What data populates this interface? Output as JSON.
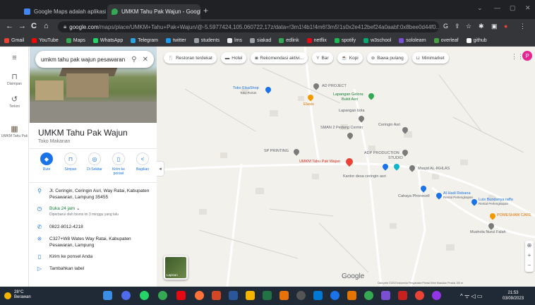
{
  "browser": {
    "tabs": [
      {
        "title": "Google Maps adalah aplikasi..",
        "close": "×",
        "active": false
      },
      {
        "title": "UMKM Tahu Pak Wajun - Googl",
        "close": "×",
        "active": true
      }
    ],
    "new_tab": "+",
    "window_controls": [
      "⌄",
      "—",
      "▢",
      "✕"
    ],
    "nav": {
      "back": "←",
      "forward": "→",
      "reload": "C",
      "home": "⌂"
    },
    "url_host": "google.com",
    "url_path": "/maps/place/UMKM+Tahu+Pak+Wajun/@-5.5977424,105.060722,17z/data=!3m1!4b1!4m6!3m5!1s0x2e412bef24a0aabf:0x8bee0d44f0...",
    "toolbar_icons": [
      "G",
      "⇪",
      "☆",
      "✱",
      "▣",
      "●",
      "⋮"
    ]
  },
  "bookmarks": [
    {
      "label": "Gmail",
      "color": "#ea4335"
    },
    {
      "label": "YouTube",
      "color": "#ff0000"
    },
    {
      "label": "Maps",
      "color": "#34a853"
    },
    {
      "label": "WhatsApp",
      "color": "#25d366"
    },
    {
      "label": "Telegram",
      "color": "#2aa3df"
    },
    {
      "label": "twitter",
      "color": "#1d9bf0"
    },
    {
      "label": "students",
      "color": "#9aa0a6"
    },
    {
      "label": "lms",
      "color": "#e8eaed"
    },
    {
      "label": "siakad",
      "color": "#9aa0a6"
    },
    {
      "label": "edlink",
      "color": "#34a853"
    },
    {
      "label": "netflix",
      "color": "#e50914"
    },
    {
      "label": "spotify",
      "color": "#1db954"
    },
    {
      "label": "w3school",
      "color": "#04aa6d"
    },
    {
      "label": "sololearn",
      "color": "#7b4fd4"
    },
    {
      "label": "overleaf",
      "color": "#47a141"
    },
    {
      "label": "github",
      "color": "#ffffff"
    }
  ],
  "rail": [
    {
      "label": "Disimpan",
      "icon": "⊓"
    },
    {
      "label": "Terkini",
      "icon": "↺"
    },
    {
      "label": "UMKM Tahu Pak",
      "icon": "▦"
    }
  ],
  "search": {
    "query": "umkm tahu pak wajun pesawaran",
    "search_icon": "⚲",
    "close_icon": "✕"
  },
  "place": {
    "title": "UMKM Tahu Pak Wajun",
    "category": "Toko Makanan",
    "actions": [
      {
        "label": "Rute",
        "icon": "◆"
      },
      {
        "label": "Simpan",
        "icon": "⊓"
      },
      {
        "label": "Di Sekitar",
        "icon": "◎"
      },
      {
        "label": "Kirim ke ponsel",
        "icon": "▯"
      },
      {
        "label": "Bagikan",
        "icon": "<"
      }
    ],
    "address": "Jl. Ceringin, Ceringin Asri, Way Ratai, Kabupaten Pesawaran, Lampung 35455",
    "hours_status": "Buka 24 jam",
    "hours_note": "Diperbarui oleh bisnis ini 3 minggu yang lalu",
    "phone": "0822-8012-4218",
    "plus_code": "C327+W8 Wates Way Ratai, Kabupaten Pesawaran, Lampung",
    "send_to_phone": "Kirim ke ponsel Anda",
    "add_label": "Tambahkan label",
    "collapse_icon": "◂"
  },
  "map": {
    "chips": [
      {
        "label": "Restoran terdekat",
        "icon": "🍴"
      },
      {
        "label": "Hotel",
        "icon": "▬"
      },
      {
        "label": "Rekomendasi aktivi...",
        "icon": "◙"
      },
      {
        "label": "Bar",
        "icon": "Y"
      },
      {
        "label": "Kopi",
        "icon": "☕"
      },
      {
        "label": "Bawa pulang",
        "icon": "⊕"
      },
      {
        "label": "Minimarket",
        "icon": "⊔"
      }
    ],
    "apps_icon": "⋮⋮⋮",
    "avatar_letter": "P",
    "labels": {
      "toko_elsashop": "Toko ElsaShop",
      "toko_elsashop_sub": "Toko Rokok",
      "ad_project": "AD PROJECT",
      "lapangan_gelora": "Lapangan Gelora",
      "bukit_asri": "Bukit Asri",
      "elaxio": "Elaxio",
      "lapangan_bola": "Lapangan bola",
      "sman2": "SMAN 2 Pedang Cermin",
      "ceringin_asri": "Ceringin Asri",
      "sp_printing": "SP PRINTING",
      "adp_production": "ADP PRODUCTION",
      "adp_studio": "STUDIO",
      "umkm": "UMKM Tahu Pak Wajun",
      "masjid": "Masjid AL-IKHLAS",
      "kantor_desa": "Kantor desa ceringin asri",
      "cahaya": "Cahaya Phonecell",
      "alhadi": "Al Hadi Rebana",
      "alhadi_sub": "Rental Perlengkapan",
      "luisbundanya": "Luis Bundanya raffa",
      "luis_sub": "Rental Perlengkapan",
      "pomeshaw": "POMESHAW CAFE",
      "mushola": "Mushola Nurul Falah"
    },
    "layers_label": "Lapisan",
    "google_logo": "Google",
    "footer": "Data peta ©2023   Indonesia   Persyaratan   Privasi   Kirim Masukan Produk   100 m",
    "zoom": [
      "⊕",
      "+",
      "−"
    ]
  },
  "taskbar": {
    "temp": "28°C",
    "weather": "Berawan",
    "tray": "^ ᯤ ◁ ▭",
    "time": "21:53",
    "date": "03/09/2023"
  }
}
